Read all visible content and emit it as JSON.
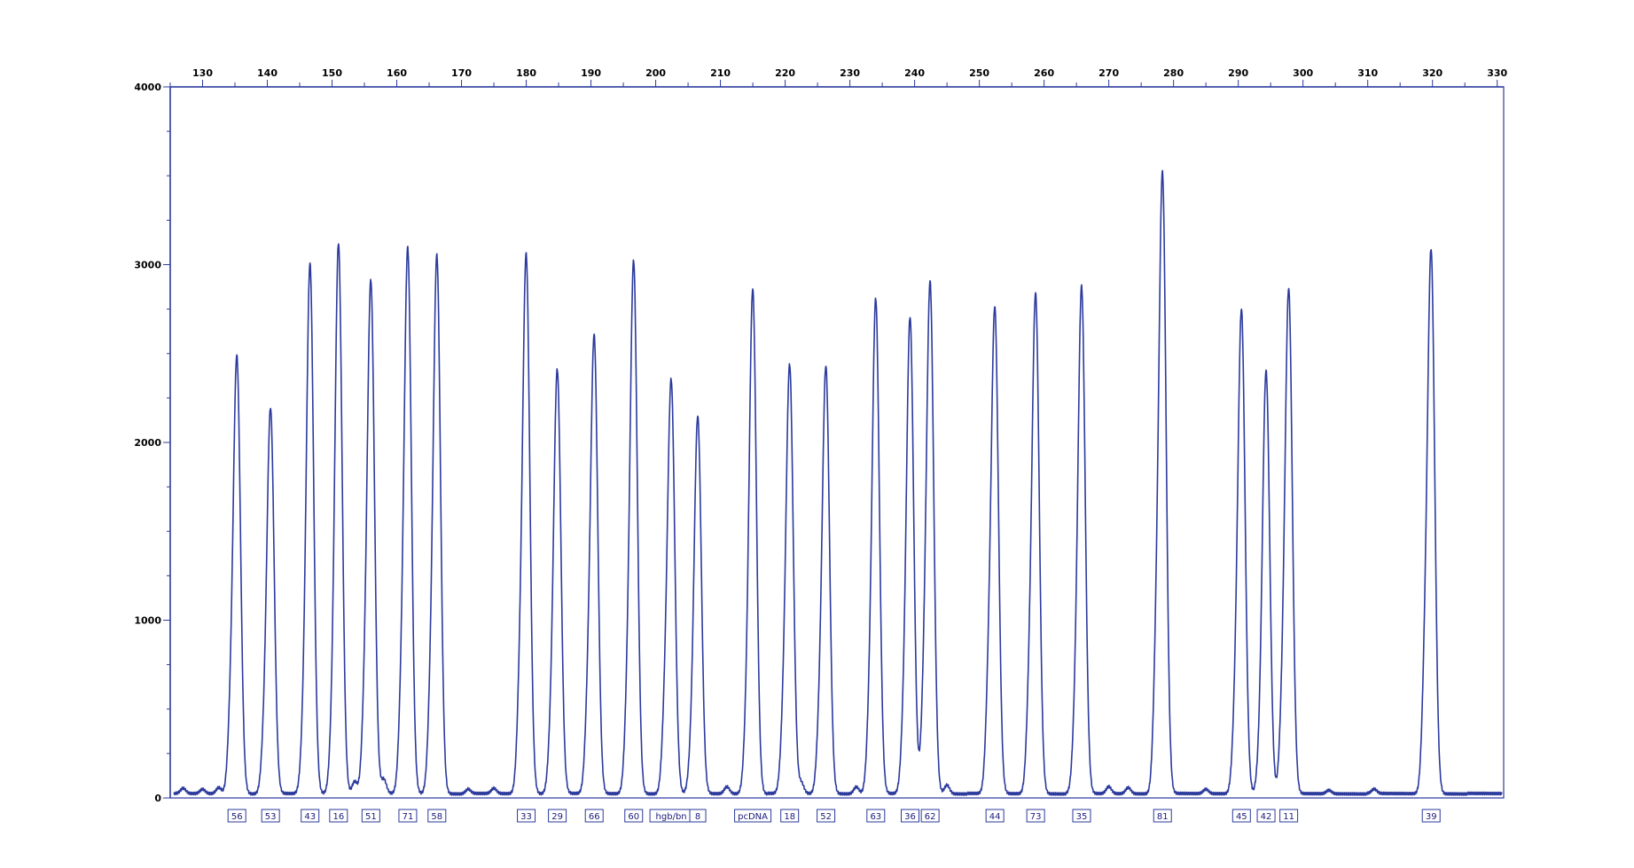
{
  "chart_data": {
    "type": "line",
    "title": "",
    "xlabel": "",
    "ylabel": "",
    "xlim": [
      125,
      331
    ],
    "ylim": [
      0,
      4000
    ],
    "x_ticks": [
      130,
      140,
      150,
      160,
      170,
      180,
      190,
      200,
      210,
      220,
      230,
      240,
      250,
      260,
      270,
      280,
      290,
      300,
      310,
      320,
      330
    ],
    "x_tick_labels": [
      "130",
      "140",
      "150",
      "160",
      "170",
      "180",
      "190",
      "200",
      "210",
      "220",
      "230",
      "240",
      "250",
      "260",
      "270",
      "280",
      "290",
      "300",
      "310",
      "320",
      "330"
    ],
    "y_ticks": [
      0,
      1000,
      2000,
      3000,
      4000
    ],
    "y_tick_labels": [
      "0",
      "1000",
      "2000",
      "3000",
      "4000"
    ],
    "x_axis_position": "top",
    "grid": false,
    "line_color": "#2b3a9c",
    "peaks": [
      {
        "x": 135.3,
        "height": 2440,
        "shoulder": 300,
        "label": "56"
      },
      {
        "x": 140.5,
        "height": 2150,
        "shoulder": 220,
        "label": "53"
      },
      {
        "x": 146.6,
        "height": 2960,
        "shoulder": 250,
        "label": "43"
      },
      {
        "x": 151.0,
        "height": 3080,
        "shoulder": 200,
        "label": "16"
      },
      {
        "x": 156.0,
        "height": 2860,
        "shoulder": 330,
        "label": "51"
      },
      {
        "x": 161.7,
        "height": 3040,
        "shoulder": 370,
        "label": "71"
      },
      {
        "x": 166.2,
        "height": 3000,
        "shoulder": 360,
        "label": "58"
      },
      {
        "x": 180.0,
        "height": 3000,
        "shoulder": 430,
        "label": "33"
      },
      {
        "x": 184.8,
        "height": 2370,
        "shoulder": 220,
        "label": "29"
      },
      {
        "x": 190.5,
        "height": 2550,
        "shoulder": 360,
        "label": "66"
      },
      {
        "x": 196.6,
        "height": 2970,
        "shoulder": 350,
        "label": "60"
      },
      {
        "x": 202.4,
        "height": 2300,
        "shoulder": 350,
        "label": "hgb/bn"
      },
      {
        "x": 206.5,
        "height": 2110,
        "shoulder": 150,
        "label": "8"
      },
      {
        "x": 215.0,
        "height": 2820,
        "shoulder": 240,
        "label": "pcDNA"
      },
      {
        "x": 220.7,
        "height": 2390,
        "shoulder": 280,
        "label": "18"
      },
      {
        "x": 226.3,
        "height": 2380,
        "shoulder": 290,
        "label": "52"
      },
      {
        "x": 234.0,
        "height": 2760,
        "shoulder": 280,
        "label": "63"
      },
      {
        "x": 239.3,
        "height": 2660,
        "shoulder": 250,
        "label": "36"
      },
      {
        "x": 242.4,
        "height": 2850,
        "shoulder": 380,
        "label": "62"
      },
      {
        "x": 252.4,
        "height": 2700,
        "shoulder": 450,
        "label": "44"
      },
      {
        "x": 258.7,
        "height": 2780,
        "shoulder": 410,
        "label": "73"
      },
      {
        "x": 265.8,
        "height": 2830,
        "shoulder": 280,
        "label": "35"
      },
      {
        "x": 278.3,
        "height": 3450,
        "shoulder": 580,
        "label": "81"
      },
      {
        "x": 290.5,
        "height": 2700,
        "shoulder": 310,
        "label": "45"
      },
      {
        "x": 294.3,
        "height": 2370,
        "shoulder": 130,
        "label": "42"
      },
      {
        "x": 297.8,
        "height": 2810,
        "shoulder": 360,
        "label": "11"
      },
      {
        "x": 319.8,
        "height": 3020,
        "shoulder": 520,
        "label": "39"
      }
    ],
    "noise": [
      {
        "x": 127.0,
        "height": 30
      },
      {
        "x": 130.0,
        "height": 25
      },
      {
        "x": 132.5,
        "height": 35
      },
      {
        "x": 153.5,
        "height": 70
      },
      {
        "x": 158.0,
        "height": 80
      },
      {
        "x": 171.0,
        "height": 25
      },
      {
        "x": 175.0,
        "height": 30
      },
      {
        "x": 211.0,
        "height": 40
      },
      {
        "x": 222.5,
        "height": 60
      },
      {
        "x": 231.0,
        "height": 40
      },
      {
        "x": 245.0,
        "height": 50
      },
      {
        "x": 270.0,
        "height": 40
      },
      {
        "x": 273.0,
        "height": 35
      },
      {
        "x": 285.0,
        "height": 25
      },
      {
        "x": 304.0,
        "height": 20
      },
      {
        "x": 311.0,
        "height": 25
      }
    ]
  }
}
